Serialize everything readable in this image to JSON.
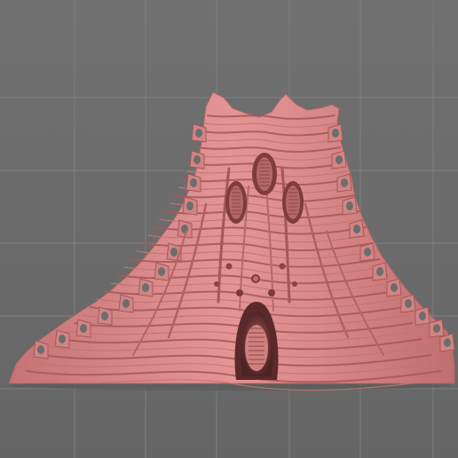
{
  "viewport": {
    "background_color": "#6b6b6b",
    "grid_color": "#7e7e7e",
    "grid_visible": true
  },
  "model": {
    "name": "sculpt-model",
    "base_color": "#d98888",
    "shadow_color": "#9a5050",
    "deep_shadow_color": "#5e2f2f",
    "highlight_color": "#f0a8a8"
  }
}
